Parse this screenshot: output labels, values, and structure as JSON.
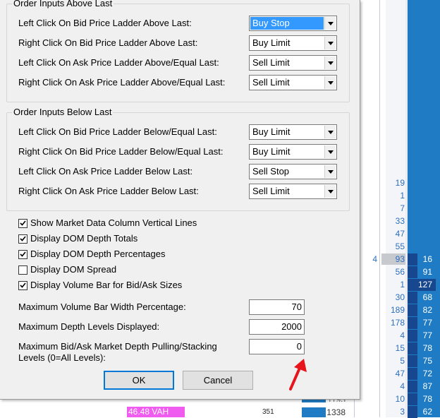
{
  "dialog": {
    "group_above": {
      "title": "Order Inputs Above Last",
      "rows": [
        {
          "label": "Left Click On Bid Price Ladder Above Last:",
          "value": "Buy Stop",
          "selected": true
        },
        {
          "label": "Right Click On Bid Price Ladder Above Last:",
          "value": "Buy Limit",
          "selected": false
        },
        {
          "label": "Left Click On Ask Price Ladder Above/Equal Last:",
          "value": "Sell Limit",
          "selected": false
        },
        {
          "label": "Right Click On Ask Price Ladder Above/Equal Last:",
          "value": "Sell Limit",
          "selected": false
        }
      ]
    },
    "group_below": {
      "title": "Order Inputs Below Last",
      "rows": [
        {
          "label": "Left Click On Bid Price Ladder Below/Equal Last:",
          "value": "Buy Limit",
          "selected": false
        },
        {
          "label": "Right Click On Bid Price Ladder Below/Equal Last:",
          "value": "Buy Limit",
          "selected": false
        },
        {
          "label": "Left Click On Ask Price Ladder Below Last:",
          "value": "Sell Stop",
          "selected": false
        },
        {
          "label": "Right Click On Ask Price Ladder Below Last:",
          "value": "Sell Limit",
          "selected": false
        }
      ]
    },
    "checkboxes": [
      {
        "label": "Show Market Data Column Vertical Lines",
        "checked": true
      },
      {
        "label": "Display DOM Depth Totals",
        "checked": true
      },
      {
        "label": "Display DOM Depth Percentages",
        "checked": true
      },
      {
        "label": "Display DOM Spread",
        "checked": false
      },
      {
        "label": "Display Volume Bar for Bid/Ask Sizes",
        "checked": true
      }
    ],
    "numeric_fields": [
      {
        "label": "Maximum Volume Bar Width Percentage:",
        "value": "70"
      },
      {
        "label": "Maximum Depth Levels Displayed:",
        "value": "2000"
      },
      {
        "label": "Maximum Bid/Ask Market Depth Pulling/Stacking",
        "label2": "Levels (0=All Levels):",
        "value": "0"
      }
    ],
    "ok_label": "OK",
    "cancel_label": "Cancel"
  },
  "background_ladder": {
    "col_a": [
      "19",
      "1",
      "7",
      "33",
      "47",
      "55",
      "93",
      "56",
      "1",
      "30",
      "189",
      "178",
      "4",
      "15",
      "5",
      "47",
      "4",
      "10",
      "3"
    ],
    "col_b": [
      "16",
      "91",
      "127",
      "68",
      "82",
      "77",
      "77",
      "78",
      "75",
      "72",
      "87",
      "78",
      "62"
    ],
    "side_value": "4",
    "vah_label": "46.48  VAH",
    "bottom_left_value": "351",
    "bottom_right_value": "1338",
    "partial_value": "1193"
  },
  "colors": {
    "accent_arrow": "#e8141c",
    "selection": "#3399ff",
    "ladder_blue": "#1f7bc3",
    "vah_magenta": "#f05bf0"
  }
}
